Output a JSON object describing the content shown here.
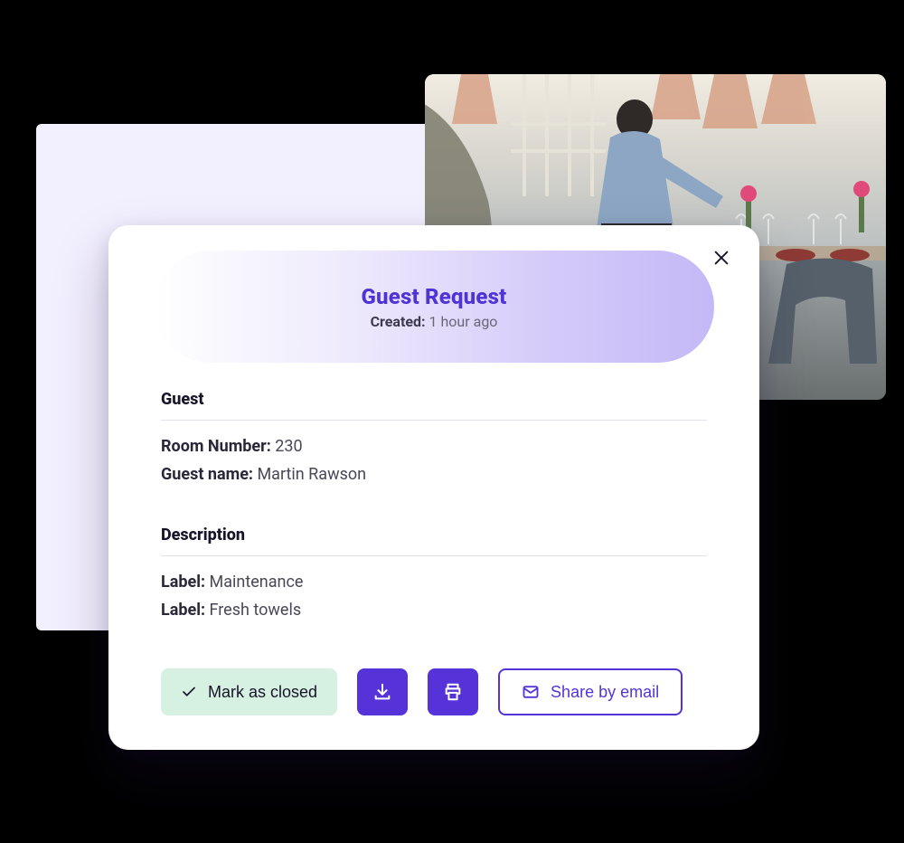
{
  "header": {
    "title": "Guest Request",
    "created_label": "Created:",
    "created_value": "1 hour ago"
  },
  "guest": {
    "section_title": "Guest",
    "room_label": "Room Number:",
    "room_value": "230",
    "name_label": "Guest name:",
    "name_value": "Martin Rawson"
  },
  "description": {
    "section_title": "Description",
    "rows": [
      {
        "label": "Label:",
        "value": "Maintenance"
      },
      {
        "label": "Label:",
        "value": "Fresh towels"
      }
    ]
  },
  "actions": {
    "mark_closed": "Mark as closed",
    "share_email": "Share by email"
  },
  "icons": {
    "close": "close-icon",
    "check": "check-icon",
    "download": "download-icon",
    "print": "print-icon",
    "mail": "mail-icon"
  }
}
